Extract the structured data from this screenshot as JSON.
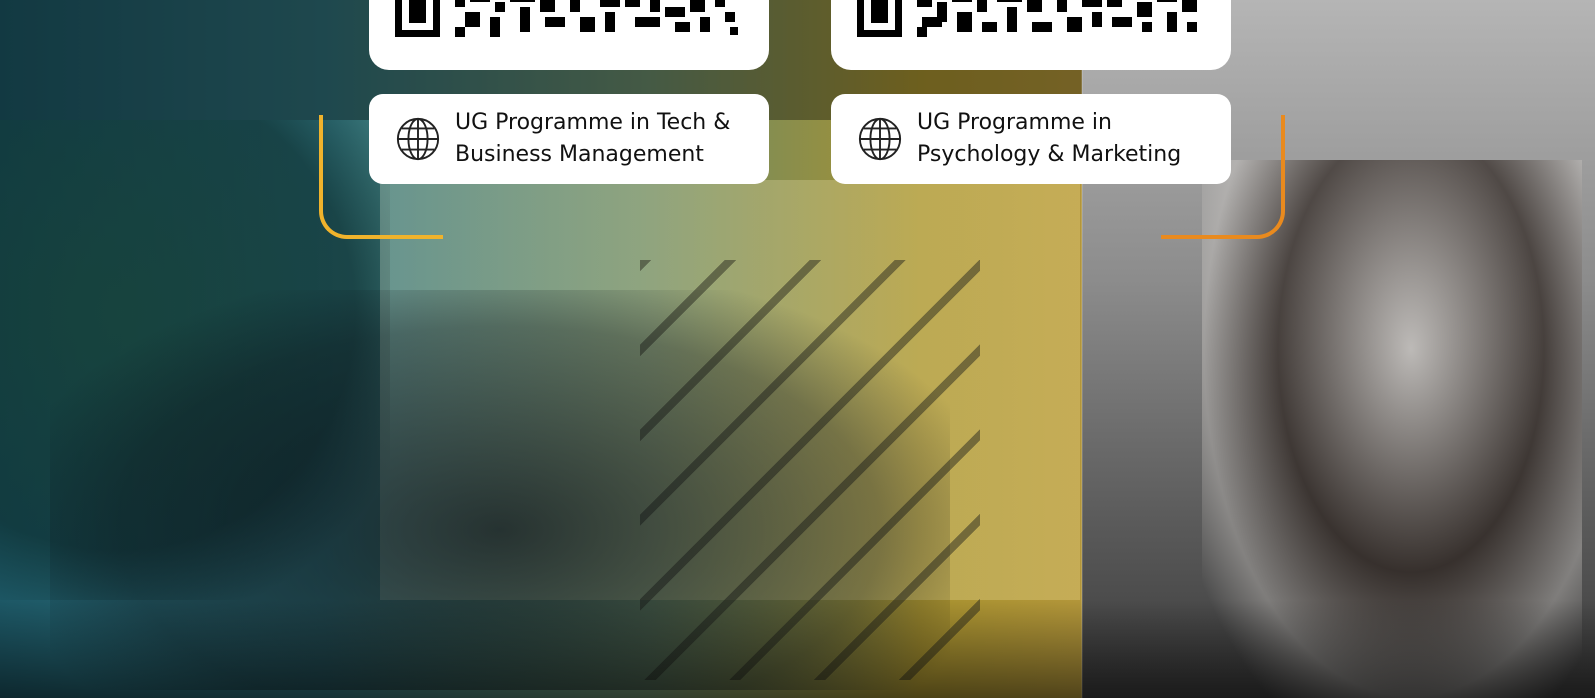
{
  "programmes": [
    {
      "title_line1": "UG Programme in Tech &",
      "title_line2": "Business Management",
      "icon": "globe-icon"
    },
    {
      "title_line1": "UG Programme in",
      "title_line2": "Psychology & Marketing",
      "icon": "globe-icon"
    }
  ],
  "colors": {
    "bracket_left": "#f0b32c",
    "bracket_right": "#e98a1e",
    "card_bg": "#ffffff"
  }
}
